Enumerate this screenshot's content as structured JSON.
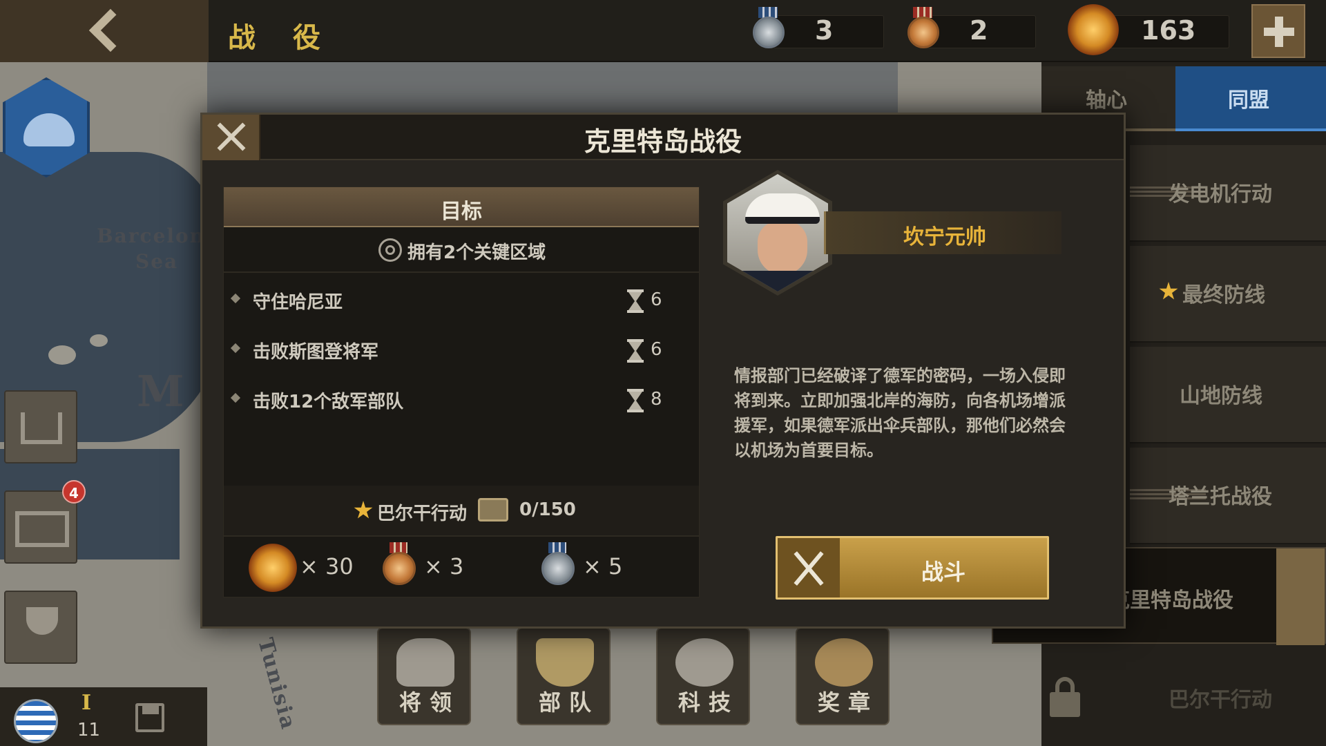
{
  "topbar": {
    "page_title": "战 役",
    "silver_medals": "3",
    "bronze_medals": "2",
    "gold_value": "163"
  },
  "map": {
    "label_barcelona": "Barcelona",
    "label_sea": "Sea",
    "label_m": "M",
    "label_tunisia": "Tunisia",
    "label_mountain_line": "山地防线"
  },
  "left": {
    "notification_count": "4",
    "rank": "I",
    "turn": "11"
  },
  "right_panel": {
    "tabs": [
      {
        "label": "轴心"
      },
      {
        "label": "同盟"
      }
    ],
    "campaigns": [
      {
        "label": "发电机行动"
      },
      {
        "label": "最终防线"
      },
      {
        "label": "山地防线"
      },
      {
        "label": "塔兰托战役"
      },
      {
        "label": "克里特岛战役"
      },
      {
        "label": "巴尔干行动"
      }
    ]
  },
  "bottom_nav": [
    {
      "label": "将领"
    },
    {
      "label": "部队"
    },
    {
      "label": "科技"
    },
    {
      "label": "奖章"
    }
  ],
  "modal": {
    "title": "克里特岛战役",
    "goal_header": "目标",
    "key_zones": "拥有2个关键区域",
    "objectives": [
      {
        "label": "守住哈尼亚",
        "turns": "6"
      },
      {
        "label": "击败斯图登将军",
        "turns": "6"
      },
      {
        "label": "击败12个敌军部队",
        "turns": "8"
      }
    ],
    "unlock": {
      "label": "巴尔干行动",
      "progress": "0/150"
    },
    "rewards": [
      {
        "icon": "gold-sun-icon",
        "value": "× 30"
      },
      {
        "icon": "bronze-medal-icon",
        "value": "× 3"
      },
      {
        "icon": "silver-medal-icon",
        "value": "× 5"
      }
    ],
    "commander_name": "坎宁元帅",
    "briefing": "情报部门已经破译了德军的密码，一场入侵即将到来。立即加强北岸的海防，向各机场增派援军，如果德军派出伞兵部队，那他们必然会以机场为首要目标。",
    "fight_label": "战斗"
  },
  "colors": {
    "accent_gold": "#e8b43a",
    "title_gold": "#d8b84a",
    "allies_blue": "#1f4f85"
  }
}
